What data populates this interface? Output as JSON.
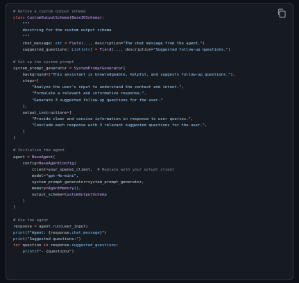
{
  "code": {
    "language": "python",
    "copy_icon": "copy-icon",
    "lines": [
      [
        {
          "t": "# Define a custom output schema",
          "c": "cm"
        }
      ],
      [
        {
          "t": "class ",
          "c": "kw"
        },
        {
          "t": "CustomOutputSchema",
          "c": "fn"
        },
        {
          "t": "(",
          "c": "df"
        },
        {
          "t": "BaseIOSchema",
          "c": "fn"
        },
        {
          "t": "):",
          "c": "df"
        }
      ],
      [
        {
          "t": "    \"\"\"",
          "c": "st"
        }
      ],
      [
        {
          "t": "    docstring for the custom output schema",
          "c": "st"
        }
      ],
      [
        {
          "t": "    \"\"\"",
          "c": "st"
        }
      ],
      [
        {
          "t": "    chat_message: ",
          "c": "df"
        },
        {
          "t": "str",
          "c": "nm"
        },
        {
          "t": " = ",
          "c": "op"
        },
        {
          "t": "Field",
          "c": "fn"
        },
        {
          "t": "(..., description=",
          "c": "df"
        },
        {
          "t": "\"The chat message from the agent.\"",
          "c": "st"
        },
        {
          "t": ")",
          "c": "df"
        }
      ],
      [
        {
          "t": "    suggested_questions: ",
          "c": "df"
        },
        {
          "t": "List",
          "c": "nm"
        },
        {
          "t": "[",
          "c": "df"
        },
        {
          "t": "str",
          "c": "nm"
        },
        {
          "t": "] ",
          "c": "df"
        },
        {
          "t": "= ",
          "c": "op"
        },
        {
          "t": "Field",
          "c": "fn"
        },
        {
          "t": "(..., description=",
          "c": "df"
        },
        {
          "t": "\"Suggested follow-up questions.\"",
          "c": "st"
        },
        {
          "t": ")",
          "c": "df"
        }
      ],
      [
        {
          "t": "",
          "c": "df"
        }
      ],
      [
        {
          "t": "# Set up the system prompt",
          "c": "cm"
        }
      ],
      [
        {
          "t": "system_prompt_generator ",
          "c": "df"
        },
        {
          "t": "= ",
          "c": "op"
        },
        {
          "t": "SystemPromptGenerator",
          "c": "fn"
        },
        {
          "t": "(",
          "c": "df"
        }
      ],
      [
        {
          "t": "    background",
          "c": "df"
        },
        {
          "t": "=",
          "c": "op"
        },
        {
          "t": "[",
          "c": "df"
        },
        {
          "t": "\"This assistant is knowledgeable, helpful, and suggests follow-up questions.\"",
          "c": "st"
        },
        {
          "t": "],",
          "c": "df"
        }
      ],
      [
        {
          "t": "    steps",
          "c": "df"
        },
        {
          "t": "=",
          "c": "op"
        },
        {
          "t": "[",
          "c": "df"
        }
      ],
      [
        {
          "t": "        \"Analyze the user's input to understand the context and intent.\"",
          "c": "st"
        },
        {
          "t": ",",
          "c": "df"
        }
      ],
      [
        {
          "t": "        \"Formulate a relevant and informative response.\"",
          "c": "st"
        },
        {
          "t": ",",
          "c": "df"
        }
      ],
      [
        {
          "t": "        \"Generate 3 suggested follow-up questions for the user.\"",
          "c": "st"
        }
      ],
      [
        {
          "t": "    ],",
          "c": "df"
        }
      ],
      [
        {
          "t": "    output_instructions",
          "c": "df"
        },
        {
          "t": "=",
          "c": "op"
        },
        {
          "t": "[",
          "c": "df"
        }
      ],
      [
        {
          "t": "        \"Provide clear and concise information in response to user queries.\"",
          "c": "st"
        },
        {
          "t": ",",
          "c": "df"
        }
      ],
      [
        {
          "t": "        \"Conclude each response with 3 relevant suggested questions for the user.\"",
          "c": "st"
        },
        {
          "t": ",",
          "c": "df"
        }
      ],
      [
        {
          "t": "    ]",
          "c": "df"
        }
      ],
      [
        {
          "t": ")",
          "c": "df"
        }
      ],
      [
        {
          "t": "",
          "c": "df"
        }
      ],
      [
        {
          "t": "# Initialize the agent",
          "c": "cm"
        }
      ],
      [
        {
          "t": "agent ",
          "c": "df"
        },
        {
          "t": "= ",
          "c": "op"
        },
        {
          "t": "BaseAgent",
          "c": "fn"
        },
        {
          "t": "(",
          "c": "df"
        }
      ],
      [
        {
          "t": "    config",
          "c": "df"
        },
        {
          "t": "=",
          "c": "op"
        },
        {
          "t": "BaseAgentConfig",
          "c": "fn"
        },
        {
          "t": "(",
          "c": "df"
        }
      ],
      [
        {
          "t": "        client",
          "c": "df"
        },
        {
          "t": "=",
          "c": "op"
        },
        {
          "t": "your_openai_client,  ",
          "c": "df"
        },
        {
          "t": "# Replace with your actual client",
          "c": "cm"
        }
      ],
      [
        {
          "t": "        model",
          "c": "df"
        },
        {
          "t": "=",
          "c": "op"
        },
        {
          "t": "\"gpt-4o-mini\"",
          "c": "st"
        },
        {
          "t": ",",
          "c": "df"
        }
      ],
      [
        {
          "t": "        system_prompt_generator",
          "c": "df"
        },
        {
          "t": "=",
          "c": "op"
        },
        {
          "t": "system_prompt_generator,",
          "c": "df"
        }
      ],
      [
        {
          "t": "        memory",
          "c": "df"
        },
        {
          "t": "=",
          "c": "op"
        },
        {
          "t": "AgentMemory",
          "c": "fn"
        },
        {
          "t": "(),",
          "c": "df"
        }
      ],
      [
        {
          "t": "        output_schema",
          "c": "df"
        },
        {
          "t": "=",
          "c": "op"
        },
        {
          "t": "CustomOutputSchema",
          "c": "fn"
        }
      ],
      [
        {
          "t": "    )",
          "c": "df"
        }
      ],
      [
        {
          "t": ")",
          "c": "df"
        }
      ],
      [
        {
          "t": "",
          "c": "df"
        }
      ],
      [
        {
          "t": "# Use the agent",
          "c": "cm"
        }
      ],
      [
        {
          "t": "response ",
          "c": "df"
        },
        {
          "t": "= ",
          "c": "op"
        },
        {
          "t": "agent.",
          "c": "df"
        },
        {
          "t": "run",
          "c": "fn"
        },
        {
          "t": "(user_input)",
          "c": "df"
        }
      ],
      [
        {
          "t": "print",
          "c": "nm"
        },
        {
          "t": "(",
          "c": "df"
        },
        {
          "t": "f\"Agent: ",
          "c": "st"
        },
        {
          "t": "{response.",
          "c": "df"
        },
        {
          "t": "chat_message",
          "c": "nm"
        },
        {
          "t": "}",
          "c": "df"
        },
        {
          "t": "\"",
          "c": "st"
        },
        {
          "t": ")",
          "c": "df"
        }
      ],
      [
        {
          "t": "print",
          "c": "nm"
        },
        {
          "t": "(",
          "c": "df"
        },
        {
          "t": "\"Suggested questions:\"",
          "c": "st"
        },
        {
          "t": ")",
          "c": "df"
        }
      ],
      [
        {
          "t": "for ",
          "c": "kw"
        },
        {
          "t": "question ",
          "c": "df"
        },
        {
          "t": "in ",
          "c": "kw"
        },
        {
          "t": "response.",
          "c": "df"
        },
        {
          "t": "suggested_questions",
          "c": "nm"
        },
        {
          "t": ":",
          "c": "df"
        }
      ],
      [
        {
          "t": "    ",
          "c": "df"
        },
        {
          "t": "print",
          "c": "nm"
        },
        {
          "t": "(",
          "c": "df"
        },
        {
          "t": "f\"- ",
          "c": "st"
        },
        {
          "t": "{question}",
          "c": "df"
        },
        {
          "t": "\"",
          "c": "st"
        },
        {
          "t": ")",
          "c": "df"
        }
      ]
    ]
  }
}
